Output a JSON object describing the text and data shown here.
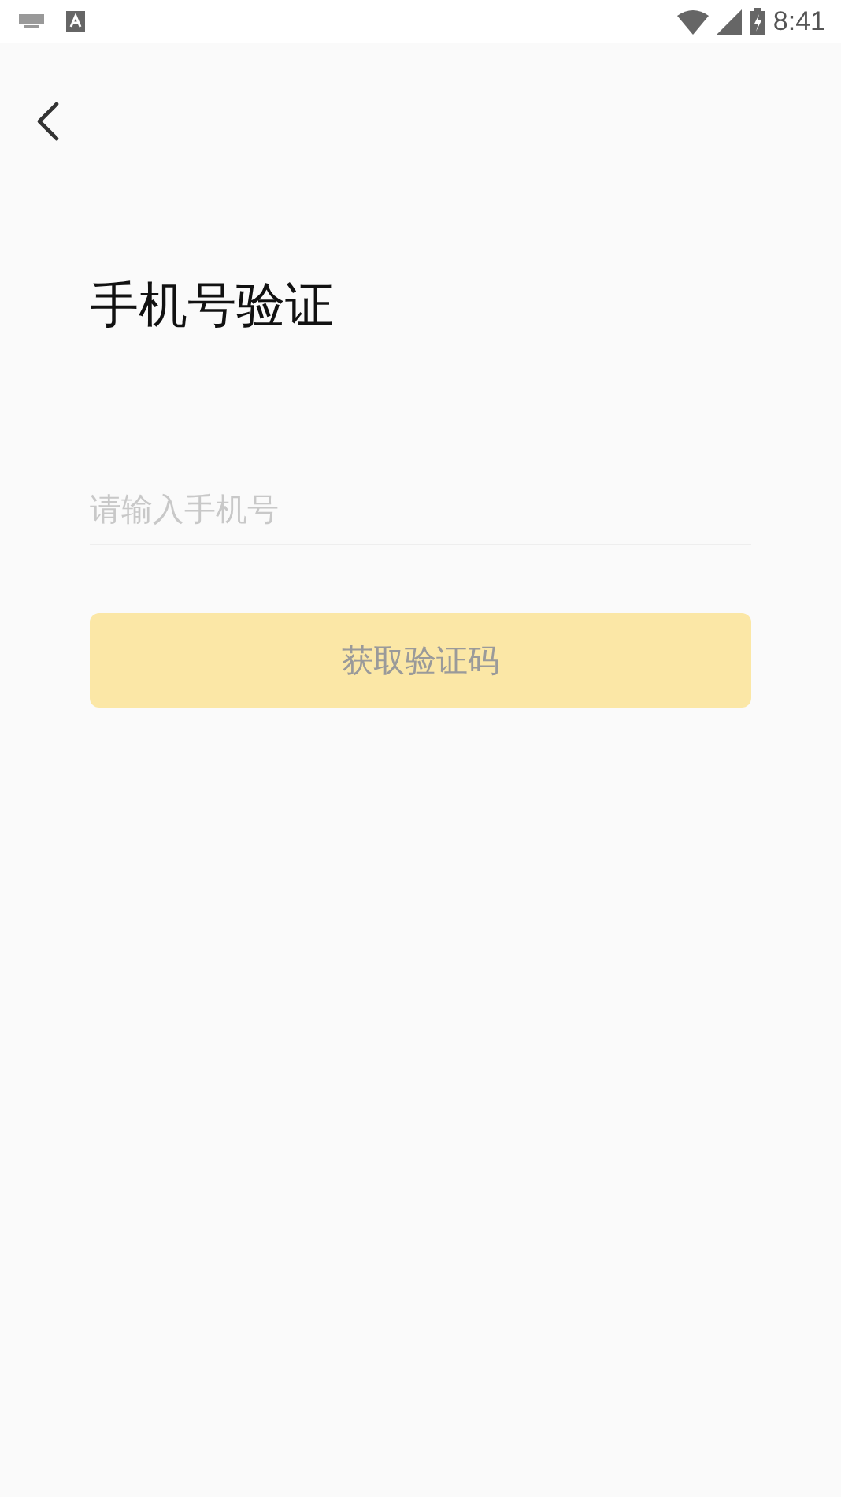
{
  "status_bar": {
    "time": "8:41"
  },
  "title": "手机号验证",
  "phone_field": {
    "placeholder": "请输入手机号"
  },
  "submit_button": {
    "label": "获取验证码",
    "disabled": true
  }
}
